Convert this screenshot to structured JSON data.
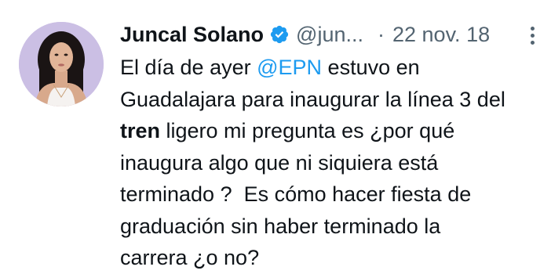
{
  "tweet": {
    "author_name": "Juncal Solano",
    "handle": "@jun...",
    "separator": "·",
    "date": "22 nov. 18",
    "icons": {
      "verified": "verified-badge-icon",
      "more": "more-options-icon"
    },
    "colors": {
      "accent": "#1d9bf0",
      "text": "#0f1419",
      "muted": "#536471"
    },
    "text_lines": [
      [
        "El día de ayer ",
        "@EPN",
        " estuvo en"
      ],
      [
        "Guadalajara para inaugurar la línea 3 del"
      ],
      [
        "tren",
        " ligero mi pregunta es ¿por qué"
      ],
      [
        "inaugura algo que ni siquiera está"
      ],
      [
        "terminado ?  Es cómo hacer fiesta de"
      ],
      [
        "graduación sin haber terminado la"
      ],
      [
        "carrera ¿o no?"
      ]
    ]
  }
}
